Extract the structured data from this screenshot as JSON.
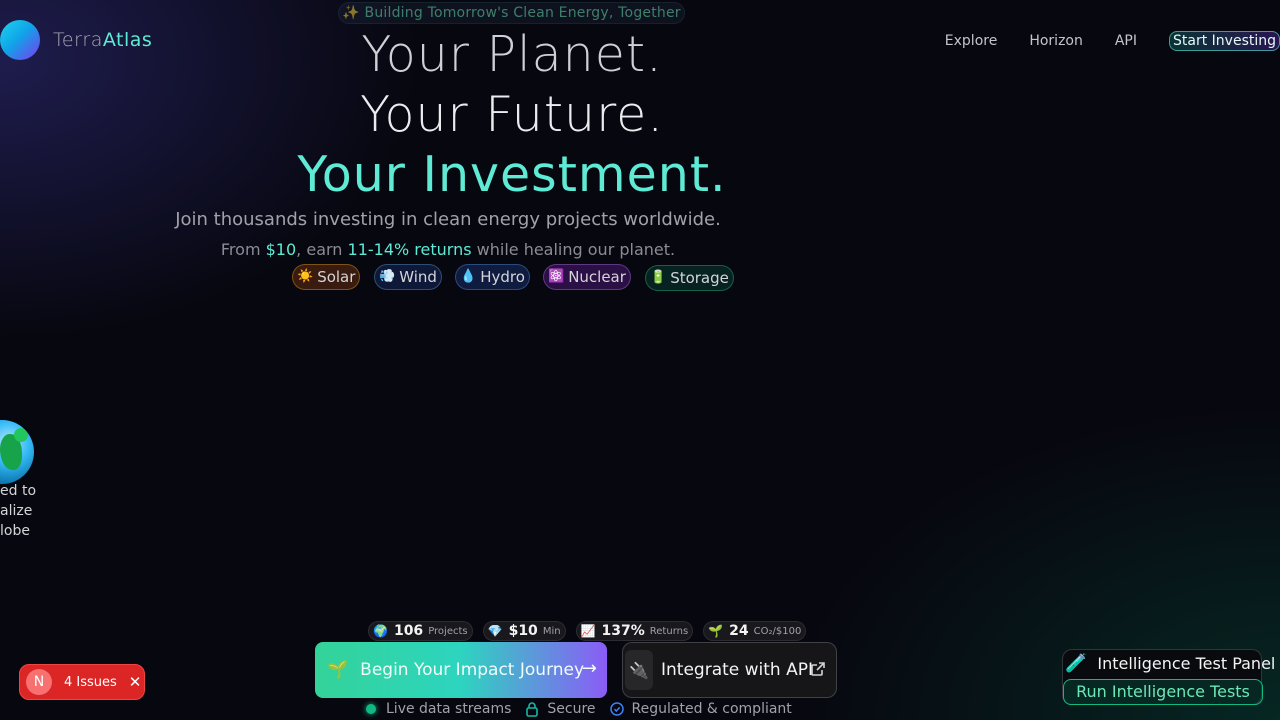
{
  "nav": {
    "logo_part1": "Terra",
    "logo_part2": "Atlas",
    "links": [
      "Explore",
      "Horizon",
      "API"
    ],
    "cta": "Start Investing"
  },
  "hero": {
    "banner": "✨ Building Tomorrow's Clean Energy, Together",
    "line1": "Your Planet.",
    "line2": "Your Future.",
    "line3": "Your Investment.",
    "subtitle": "Join thousands investing in clean energy projects worldwide.",
    "sub2_pre": "From ",
    "sub2_min": "$10",
    "sub2_mid": ", earn ",
    "sub2_returns": "11-14% returns",
    "sub2_post": " while healing our planet."
  },
  "categories": [
    {
      "icon": "☀️",
      "label": "Solar"
    },
    {
      "icon": "💨",
      "label": "Wind"
    },
    {
      "icon": "💧",
      "label": "Hydro"
    },
    {
      "icon": "⚛️",
      "label": "Nuclear"
    },
    {
      "icon": "🔋",
      "label": "Storage"
    }
  ],
  "globe": {
    "caption_l1": "ed to",
    "caption_l2": "alize",
    "caption_l3": "lobe"
  },
  "stats": [
    {
      "icon": "🌍",
      "value": "106",
      "label": "Projects"
    },
    {
      "icon": "💎",
      "value": "$10",
      "label": "Min"
    },
    {
      "icon": "📈",
      "value": "137%",
      "label": "Returns"
    },
    {
      "icon": "🌱",
      "value": "24",
      "label": "CO₂/$100"
    }
  ],
  "buttons": {
    "primary_icon": "🌱",
    "primary": "Begin Your Impact Journey",
    "primary_arrow": "→",
    "secondary_icon": "🔌",
    "secondary": "Integrate with API"
  },
  "trust": {
    "live": "Live data streams",
    "secure": "Secure",
    "regulated": "Regulated & compliant"
  },
  "issues": {
    "badge": "N",
    "text": "4 Issues",
    "close": "✕"
  },
  "panel": {
    "icon": "🧪",
    "title": "Intelligence Test Panel",
    "button": "Run Intelligence Tests"
  },
  "colors": {
    "accent": "#5eead4",
    "background": "#07070f",
    "issues": "#dc2626",
    "success": "#10b981"
  }
}
